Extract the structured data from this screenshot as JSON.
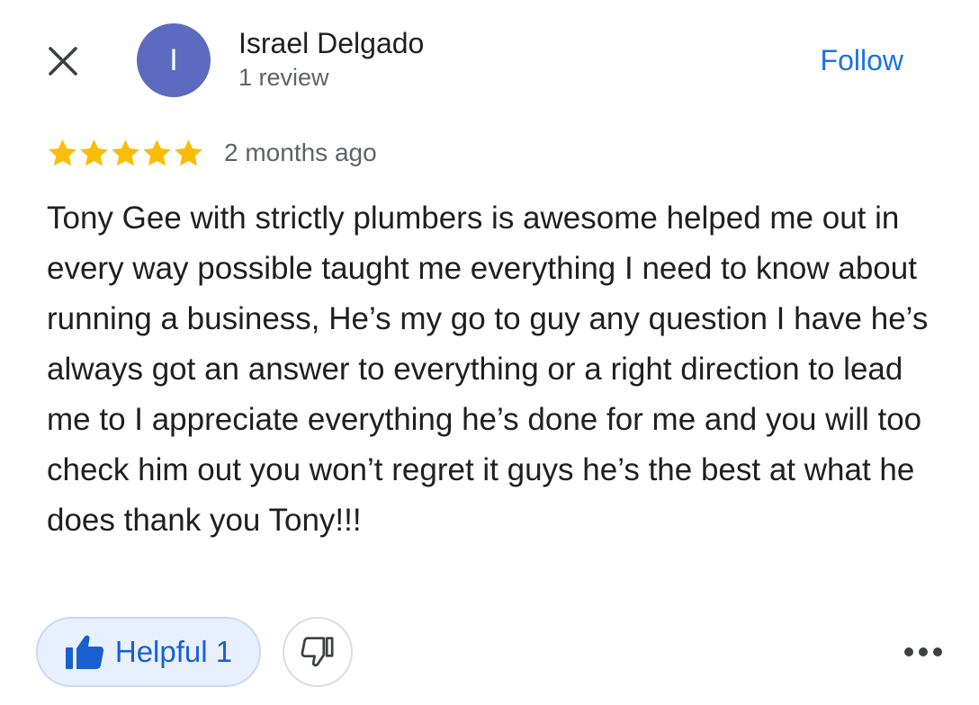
{
  "header": {
    "close_icon": "close-icon",
    "avatar_initial": "I",
    "avatar_color": "#5c6bc0",
    "reviewer_name": "Israel Delgado",
    "review_count": "1 review",
    "follow_label": "Follow",
    "follow_color": "#1a73e8"
  },
  "review": {
    "rating": 5,
    "rating_max": 5,
    "star_color": "#fbbc04",
    "date": "2 months ago",
    "text": "Tony Gee with strictly plumbers is awesome helped me out in every way possible taught me everything I need to know about running a business, He’s my go to guy any question I have he’s always got an answer to everything or a right direction to lead me to I appreciate everything he’s done for me and you will too check him out you won’t regret it guys he’s the best at what he does thank you Tony!!!"
  },
  "actions": {
    "helpful_label": "Helpful 1",
    "helpful_icon": "thumbs-up-icon",
    "dislike_icon": "thumbs-down-icon",
    "more_icon": "more-horizontal-icon"
  }
}
